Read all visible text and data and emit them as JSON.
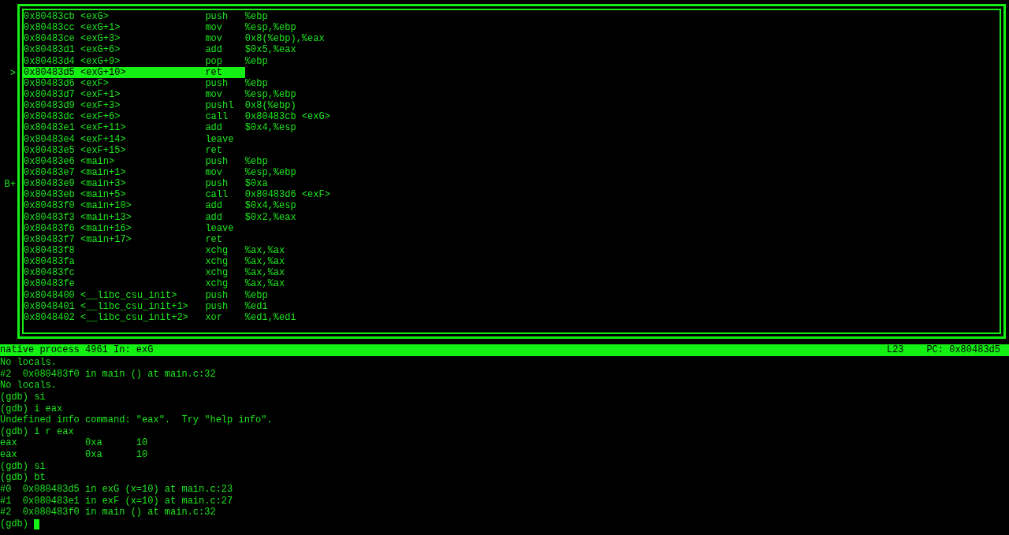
{
  "disassembly": {
    "rows": [
      {
        "marker": "",
        "address": "0x80483cb",
        "symbol": "<exG>",
        "mnemonic": "push",
        "operands": "%ebp",
        "selected": false
      },
      {
        "marker": "",
        "address": "0x80483cc",
        "symbol": "<exG+1>",
        "mnemonic": "mov",
        "operands": "%esp,%ebp",
        "selected": false
      },
      {
        "marker": "",
        "address": "0x80483ce",
        "symbol": "<exG+3>",
        "mnemonic": "mov",
        "operands": "0x8(%ebp),%eax",
        "selected": false
      },
      {
        "marker": "",
        "address": "0x80483d1",
        "symbol": "<exG+6>",
        "mnemonic": "add",
        "operands": "$0x5,%eax",
        "selected": false
      },
      {
        "marker": "",
        "address": "0x80483d4",
        "symbol": "<exG+9>",
        "mnemonic": "pop",
        "operands": "%ebp",
        "selected": false
      },
      {
        "marker": ">",
        "address": "0x80483d5",
        "symbol": "<exG+10>",
        "mnemonic": "ret",
        "operands": "",
        "selected": true
      },
      {
        "marker": "",
        "address": "0x80483d6",
        "symbol": "<exF>",
        "mnemonic": "push",
        "operands": "%ebp",
        "selected": false
      },
      {
        "marker": "",
        "address": "0x80483d7",
        "symbol": "<exF+1>",
        "mnemonic": "mov",
        "operands": "%esp,%ebp",
        "selected": false
      },
      {
        "marker": "",
        "address": "0x80483d9",
        "symbol": "<exF+3>",
        "mnemonic": "pushl",
        "operands": "0x8(%ebp)",
        "selected": false
      },
      {
        "marker": "",
        "address": "0x80483dc",
        "symbol": "<exF+6>",
        "mnemonic": "call",
        "operands": "0x80483cb <exG>",
        "selected": false
      },
      {
        "marker": "",
        "address": "0x80483e1",
        "symbol": "<exF+11>",
        "mnemonic": "add",
        "operands": "$0x4,%esp",
        "selected": false
      },
      {
        "marker": "",
        "address": "0x80483e4",
        "symbol": "<exF+14>",
        "mnemonic": "leave",
        "operands": "",
        "selected": false
      },
      {
        "marker": "",
        "address": "0x80483e5",
        "symbol": "<exF+15>",
        "mnemonic": "ret",
        "operands": "",
        "selected": false
      },
      {
        "marker": "",
        "address": "0x80483e6",
        "symbol": "<main>",
        "mnemonic": "push",
        "operands": "%ebp",
        "selected": false
      },
      {
        "marker": "",
        "address": "0x80483e7",
        "symbol": "<main+1>",
        "mnemonic": "mov",
        "operands": "%esp,%ebp",
        "selected": false
      },
      {
        "marker": "B+",
        "address": "0x80483e9",
        "symbol": "<main+3>",
        "mnemonic": "push",
        "operands": "$0xa",
        "selected": false
      },
      {
        "marker": "",
        "address": "0x80483eb",
        "symbol": "<main+5>",
        "mnemonic": "call",
        "operands": "0x80483d6 <exF>",
        "selected": false
      },
      {
        "marker": "",
        "address": "0x80483f0",
        "symbol": "<main+10>",
        "mnemonic": "add",
        "operands": "$0x4,%esp",
        "selected": false
      },
      {
        "marker": "",
        "address": "0x80483f3",
        "symbol": "<main+13>",
        "mnemonic": "add",
        "operands": "$0x2,%eax",
        "selected": false
      },
      {
        "marker": "",
        "address": "0x80483f6",
        "symbol": "<main+16>",
        "mnemonic": "leave",
        "operands": "",
        "selected": false
      },
      {
        "marker": "",
        "address": "0x80483f7",
        "symbol": "<main+17>",
        "mnemonic": "ret",
        "operands": "",
        "selected": false
      },
      {
        "marker": "",
        "address": "0x80483f8",
        "symbol": "",
        "mnemonic": "xchg",
        "operands": "%ax,%ax",
        "selected": false
      },
      {
        "marker": "",
        "address": "0x80483fa",
        "symbol": "",
        "mnemonic": "xchg",
        "operands": "%ax,%ax",
        "selected": false
      },
      {
        "marker": "",
        "address": "0x80483fc",
        "symbol": "",
        "mnemonic": "xchg",
        "operands": "%ax,%ax",
        "selected": false
      },
      {
        "marker": "",
        "address": "0x80483fe",
        "symbol": "",
        "mnemonic": "xchg",
        "operands": "%ax,%ax",
        "selected": false
      },
      {
        "marker": "",
        "address": "0x8048400",
        "symbol": "<__libc_csu_init>",
        "mnemonic": "push",
        "operands": "%ebp",
        "selected": false
      },
      {
        "marker": "",
        "address": "0x8048401",
        "symbol": "<__libc_csu_init+1>",
        "mnemonic": "push",
        "operands": "%edi",
        "selected": false
      },
      {
        "marker": "",
        "address": "0x8048402",
        "symbol": "<__libc_csu_init+2>",
        "mnemonic": "xor",
        "operands": "%edi,%edi",
        "selected": false
      }
    ]
  },
  "status_bar": {
    "process": "native process 4961",
    "function": "In: exG",
    "line": "L23",
    "pc": "PC: 0x80483d5"
  },
  "console": {
    "lines": [
      "No locals.",
      "#2  0x080483f0 in main () at main.c:32",
      "No locals.",
      "(gdb) si",
      "(gdb) i eax",
      "Undefined info command: \"eax\".  Try \"help info\".",
      "(gdb) i r eax",
      "eax            0xa      10",
      "eax            0xa      10",
      "(gdb) si",
      "(gdb) bt",
      "#0  0x080483d5 in exG (x=10) at main.c:23",
      "#1  0x080483e1 in exF (x=10) at main.c:27",
      "#2  0x080483f0 in main () at main.c:32"
    ],
    "prompt": "(gdb) "
  }
}
